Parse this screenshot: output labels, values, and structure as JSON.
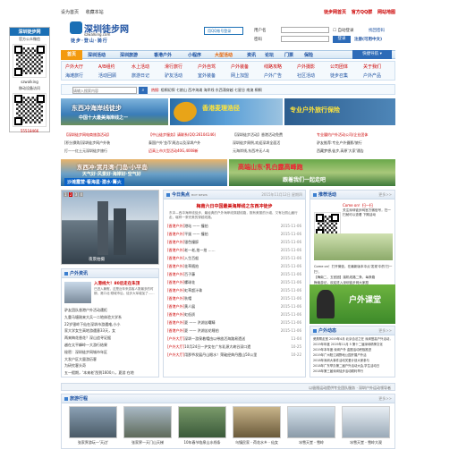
{
  "left_panel": {
    "title": "深圳徒步网",
    "subtitle": "官方公众微信",
    "id": "szwalking",
    "app_label": "移动设备访问",
    "qq": "55518466"
  },
  "topbar": {
    "links": [
      "设为首页",
      "收藏本站"
    ],
    "right_links": [
      "徒步网首页",
      "官方QQ群",
      "网站地图"
    ]
  },
  "logo": {
    "name": "深圳徒步网",
    "domain": "szwalking.com",
    "slogan": "徒步·登山·骑行"
  },
  "header": {
    "qq_button": "用QQ帐号登录"
  },
  "login": {
    "user_label": "用户名",
    "pass_label": "密码",
    "auto_login": "自动登录",
    "find_pwd": "找回密码",
    "login_btn": "登录",
    "register": "注册(可用中文)"
  },
  "nav": {
    "items": [
      "首页",
      "深圳活动",
      "深圳旅游",
      "香港户外",
      "小程序",
      "大型活动",
      "资讯",
      "论坛",
      "门票",
      "保险"
    ],
    "quick": "快捷导航"
  },
  "categories": {
    "row1": [
      "户外大厅",
      "A/B组约",
      "水上活动",
      "滑行旅行",
      "户外自驾",
      "户外装备",
      "线路攻略",
      "户外摄影",
      "公司团体",
      "关于我们"
    ],
    "row2": [
      "海滩旅行",
      "活动回顾",
      "旅游日记",
      "驴友活动",
      "室外装备",
      "网上加盟",
      "户外广告",
      "社区活动",
      "徒步召集",
      "户外产品"
    ]
  },
  "search": {
    "placeholder": "请输入搜索内容",
    "hot_label": "热搜:",
    "hot": [
      "梧桐初探",
      "七娘山",
      "西冲海滩",
      "海岸线",
      "东西涌穿越",
      "七星谷",
      "南澳",
      "桐桐"
    ]
  },
  "banners": {
    "b1_title": "东西冲海岸线徒步",
    "b1_sub": "中国十大最美海岸线之一",
    "b2_title": "香港麦理浩径",
    "b2_sub": "专业户外旅行保险",
    "b3_title": "东西冲·赏月湾·门岛·小平岛",
    "b3_sub": "天气好·风景好·海岸好·空气好",
    "b3_badge": "沙滩露营·看海星·潜水·篝火",
    "b4_title": "高端山东·乳白露高峰跑",
    "b4_sub": "跟着我们一起走吧"
  },
  "link_rows": {
    "col1": [
      "【深圳徒步网电商旅游活动】",
      "[积分换购]深圳徒步网户外装",
      [
        "打—一红土元深圳徒步旅行"
      ]
    ],
    "col2": [
      "【中山徒步服务】请联系(QQ:26104146)",
      "泰国户外'金币'周边以及深圳户外",
      "迈高上市大型活动40G,4008新"
    ],
    "col3": [
      "【深圳徒步活动】香港活动免费",
      "深圳徒步周例,欢迎深圳全面活",
      "元海岸线,东西冲无人岛"
    ],
    "col4": [
      "专业履约户外活动公司/企业团体",
      "驴友推荐:专业户外摄影/旅行",
      "西藏梦想,徒步,高原'大家'通告"
    ]
  },
  "gallery": {
    "pages": [
      "1",
      "2",
      "3",
      "4"
    ],
    "caption": "夜景拍摄"
  },
  "news": {
    "tab": "今日焦点",
    "tab_sub": "HOT NEWS",
    "date": "2015年11月12日 星期四",
    "headline": "梅南六日中国最美海岸线之东西冲徒步",
    "summary": "东冲—西冲海岸线徒步，最经典的户外海岸线穿越线路，既有美丽的沙滩、又有壮丽山崖行走，堪称一条完美的穿越线路。",
    "items": [
      {
        "tag": "[香港户外]",
        "title": "港站 —— 撞拍",
        "date": "2015-11-06"
      },
      {
        "tag": "[香港户外]",
        "title": "平拔 —— 撞拍",
        "date": "2015-11-06"
      },
      {
        "tag": "[香港户外]",
        "title": "银色撞醉",
        "date": "2015-11-06"
      },
      {
        "tag": "[香港户外]",
        "title": "老一老,拍一拍 ……",
        "date": "2015-11-06"
      },
      {
        "tag": "[香港户外]",
        "title": "入生百般",
        "date": "2015-11-06"
      },
      {
        "tag": "[香港户外]",
        "title": "花草随拍",
        "date": "2015-11-06"
      },
      {
        "tag": "[香港户外]",
        "title": "百子藤",
        "date": "2015-11-06"
      },
      {
        "tag": "[香港户外]",
        "title": "螺球花",
        "date": "2015-11-06"
      },
      {
        "tag": "[香港户外]",
        "title": "虹草超汁珠",
        "date": "2015-11-06"
      },
      {
        "tag": "[香港户外]",
        "title": "秋帽",
        "date": "2015-11-06"
      },
      {
        "tag": "[香港户外]",
        "title": "黄人展",
        "date": "2015-11-06"
      },
      {
        "tag": "[香港户外]",
        "title": "虹低质",
        "date": "2015-11-06"
      },
      {
        "tag": "[香港户外]",
        "title": "夏 —— 洪湖苦曙睛",
        "date": "2015-11-06"
      },
      {
        "tag": "[香港户外]",
        "title": "夏 —— 洪湖苦花睡拍",
        "date": "2015-11-06"
      },
      {
        "tag": "[户外大厅]",
        "title": "深圳一游泉着帽由以带放活海路易遗送",
        "date": "11-04"
      },
      {
        "tag": "[户外大厅]",
        "title": "10月24日一护女在广东乳源大峡谷深口遗",
        "date": "10-25"
      },
      {
        "tag": "[户外大厅]",
        "title": "用那爷发展丹山眼水！荣破经典丹霞山50公里",
        "date": "10-22"
      }
    ]
  },
  "activity": {
    "title": "推荐活动",
    "more": "更多>>",
    "qr_text_1": "Come on！扫一扫",
    "qr_text_2": "关注深圳徒步网官方微信号，扫一扫就可以查看 下期活动",
    "lines": [
      "Come on！打开微信，在最新版本中点'发现'中的'扫一扫'，",
      "【梅南二、五官团】接机线路二条，每条路",
      "梅南游记，欢迎进入深圳徒步网大家庭",
      "新手必读：积入深圳徒步俱乐部推荐"
    ],
    "badge": "户外课堂"
  },
  "news_left": {
    "title": "户外资讯",
    "feature_title": "入港线大！80后走在朱顶",
    "feature_text": "已进入暑假，这是近年来游客人数最多的时期，港口北·刚城市后，徒步大军增加了……",
    "items": [
      "驴友团队香港户外活动遭拒",
      "九重马塘刚来大兵一二地体验大学系",
      "22岁银岭下仙在深圳市游遇难,小小",
      "家大学女生高地游遇意33天，女",
      "两来梅花香花？深山追寻证据",
      "越在太平峰岭一大游行结果",
      "秘密：深圳徒步网城市年区",
      "大发户区大量游历客",
      "为研究客头奇",
      "五一假期，'本来老'刮到1600八，夏游 在地"
    ]
  },
  "news_right": {
    "title": "户外动态",
    "more": "更多>>",
    "items": [
      "瓷燕帮走宽 2019年4月 北京合法之在 深圳登高户外活动，活动公告",
      "2019年年度 2019年11月 5 第十二届深圳精神文化",
      "2019年本年度 深圳户外 金圈活动积极推进",
      "2019年广州阳江城野地公园开展户外活",
      "2018年深圳大事件活动关爱计划大家参与",
      "2018年广东举办第二届户外活动大会,学生活动日",
      "2018年第三届深圳徒步活动顺利举行"
    ]
  },
  "footer": {
    "text": "以极限运动提供专业团队服务 · 深圳户外运动领导者"
  },
  "photos": {
    "title": "旅游行程",
    "more": "更多>>",
    "items": [
      "张家界游玩一'天边'",
      "张家界—天门山天梯",
      "10年春节临泉山水线条",
      "乌镇民家 - 荷花水乡 - 仙女",
      "冰雪天堂 - 雪岭",
      "冰雪天堂 - 雪岭大观"
    ]
  },
  "colors": {
    "brand_blue": "#1a6fb5",
    "nav_orange": "#f39a0f",
    "tag_red": "#cc0000"
  }
}
